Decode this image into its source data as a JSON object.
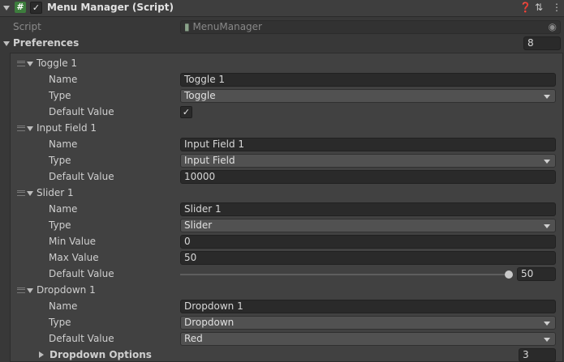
{
  "component": {
    "title": "Menu Manager (Script)",
    "icon": "csharp-script-icon",
    "enabled": true,
    "script_label": "Script",
    "script_value": "MenuManager"
  },
  "preferences": {
    "label": "Preferences",
    "size": "8",
    "toggle1": {
      "header": "Toggle 1",
      "name_label": "Name",
      "name_value": "Toggle 1",
      "type_label": "Type",
      "type_value": "Toggle",
      "default_label": "Default Value",
      "default_checked": true
    },
    "input1": {
      "header": "Input Field 1",
      "name_label": "Name",
      "name_value": "Input Field 1",
      "type_label": "Type",
      "type_value": "Input Field",
      "default_label": "Default Value",
      "default_value": "10000"
    },
    "slider1": {
      "header": "Slider 1",
      "name_label": "Name",
      "name_value": "Slider 1",
      "type_label": "Type",
      "type_value": "Slider",
      "min_label": "Min Value",
      "min_value": "0",
      "max_label": "Max Value",
      "max_value": "50",
      "default_label": "Default Value",
      "default_value": "50"
    },
    "dropdown1": {
      "header": "Dropdown 1",
      "name_label": "Name",
      "name_value": "Dropdown 1",
      "type_label": "Type",
      "type_value": "Dropdown",
      "default_label": "Default Value",
      "default_value": "Red",
      "options_label": "Dropdown Options",
      "options_size": "3"
    }
  }
}
